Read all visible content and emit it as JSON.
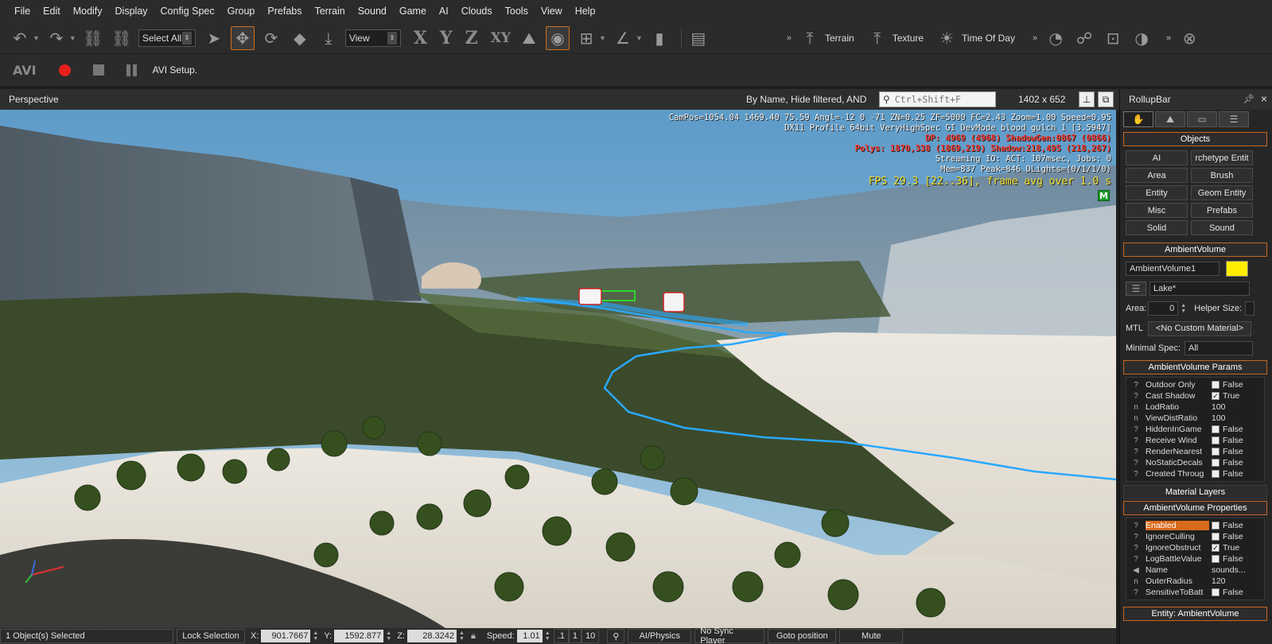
{
  "menu": [
    "File",
    "Edit",
    "Modify",
    "Display",
    "Config Spec",
    "Group",
    "Prefabs",
    "Terrain",
    "Sound",
    "Game",
    "AI",
    "Clouds",
    "Tools",
    "View",
    "Help"
  ],
  "toolbar": {
    "selection_filter": "Select All",
    "ref_coord": "View",
    "axes": [
      "X",
      "Y",
      "Z",
      "XY"
    ],
    "terrain_label": "Terrain",
    "texture_label": "Texture",
    "time_of_day_label": "Time Of Day",
    "more": "»"
  },
  "avi_toolbar": {
    "label": "AVI",
    "setup_label": "AVI Setup."
  },
  "viewport": {
    "title": "Perspective",
    "filter_text": "By Name, Hide filtered, AND",
    "search_placeholder": "Ctrl+Shift+F",
    "resolution": "1402 x 652",
    "stats": {
      "line1": "CamPos=1054.04 1469.40 75.59 Angl=-12  0 -71 ZN=0.25 ZF=5000 FC=2.43 Zoom=1.00 Speed=0.95",
      "line2": "DX11 Profile 64bit VeryHighSpec GI DevMode blood gulch 1 [3.5947]",
      "line3": "DP: 4969 (4968) ShadowGen:0867 (0866)",
      "line4": "Polys: 1870,338 (1869,219) Shadow:218,495 (218,267)",
      "line5": "Streaming IO: ACT: 107msec, Jobs: 0",
      "line6": "Mem=837 Peak=846 DLights=(0/1/1/0)",
      "fps": "FPS 29.3 [22..36], frame avg over 1.0 s"
    },
    "badge": "M"
  },
  "statusbar": {
    "selected": "1 Object(s) Selected",
    "lock": "Lock Selection",
    "x_label": "X:",
    "x": "901.7667",
    "y_label": "Y:",
    "y": "1592.877",
    "z_label": "Z:",
    "z": "28.3242",
    "speed_label": "Speed:",
    "speed": "1.01",
    "speed_presets": [
      ".1",
      "1",
      "10"
    ],
    "ai_physics": "AI/Physics",
    "no_sync": "No Sync Player",
    "goto": "Goto position",
    "mute": "Mute"
  },
  "rollup": {
    "title": "RollupBar",
    "objects_title": "Objects",
    "object_buttons": [
      "AI",
      "rchetype Entit",
      "Area",
      "Brush",
      "Entity",
      "Geom Entity",
      "Misc",
      "Prefabs",
      "Solid",
      "Sound"
    ],
    "amb_title": "AmbientVolume",
    "amb_name": "AmbientVolume1",
    "amb_color": "#ffee00",
    "layer": "Lake*",
    "area_label": "Area:",
    "area_value": "0",
    "helper_label": "Helper Size:",
    "mtl_label": "MTL",
    "mtl_value": "<No Custom Material>",
    "minspec_label": "Minimal Spec:",
    "minspec_value": "All",
    "params_title": "AmbientVolume Params",
    "params": [
      {
        "q": "?",
        "name": "Outdoor Only",
        "checked": false,
        "value": "False"
      },
      {
        "q": "?",
        "name": "Cast Shadow",
        "checked": true,
        "value": "True"
      },
      {
        "q": "n",
        "name": "LodRatio",
        "checked": null,
        "value": "100"
      },
      {
        "q": "n",
        "name": "ViewDistRatio",
        "checked": null,
        "value": "100"
      },
      {
        "q": "?",
        "name": "HiddenInGame",
        "checked": false,
        "value": "False"
      },
      {
        "q": "?",
        "name": "Receive Wind",
        "checked": false,
        "value": "False"
      },
      {
        "q": "?",
        "name": "RenderNearest",
        "checked": false,
        "value": "False"
      },
      {
        "q": "?",
        "name": "NoStaticDecals",
        "checked": false,
        "value": "False"
      },
      {
        "q": "?",
        "name": "Created Throug",
        "checked": false,
        "value": "False"
      }
    ],
    "material_layers_title": "Material Layers",
    "props_title": "AmbientVolume Properties",
    "props": [
      {
        "q": "?",
        "name": "Enabled",
        "checked": false,
        "value": "False",
        "hl": true
      },
      {
        "q": "?",
        "name": "IgnoreCulling",
        "checked": false,
        "value": "False",
        "hl": false
      },
      {
        "q": "?",
        "name": "IgnoreObstruct",
        "checked": true,
        "value": "True",
        "hl": false
      },
      {
        "q": "?",
        "name": "LogBattleValue",
        "checked": false,
        "value": "False",
        "hl": false
      },
      {
        "q": "◀",
        "name": "Name",
        "checked": null,
        "value": "sounds...",
        "hl": false
      },
      {
        "q": "n",
        "name": "OuterRadius",
        "checked": null,
        "value": "120",
        "hl": false
      },
      {
        "q": "?",
        "name": "SensitiveToBatt",
        "checked": false,
        "value": "False",
        "hl": false
      }
    ],
    "entity_title": "Entity: AmbientVolume"
  },
  "colors": {
    "accent": "#d07020",
    "record": "#e8201e",
    "stats_red": "#ff3b30",
    "fps_yellow": "#f0e02e",
    "path_cyan": "#2aa8ff"
  }
}
